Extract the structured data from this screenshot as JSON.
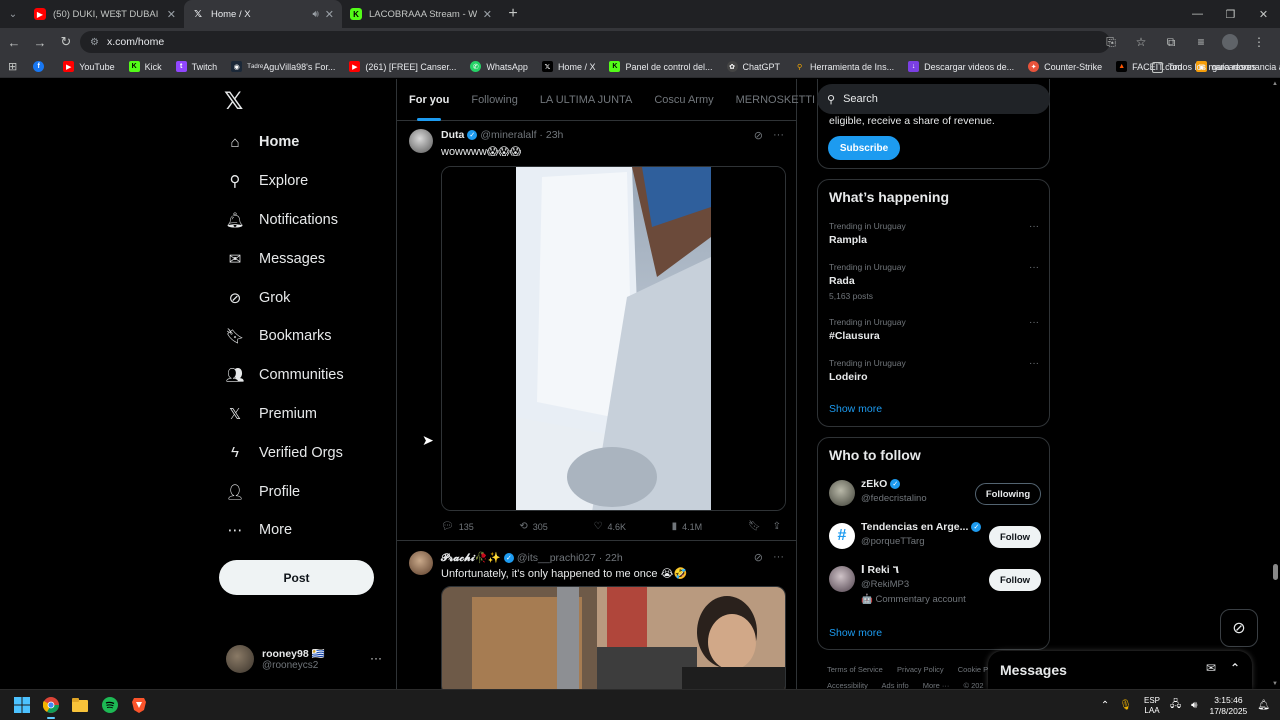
{
  "browser": {
    "tabs": [
      {
        "title": "(50) DUKI, WE$T DUBAI - cONT",
        "favicon": "youtube-icon",
        "color": "#ff0000",
        "active": false
      },
      {
        "title": "Home / X",
        "favicon": "x-icon",
        "color": "#000000",
        "active": true
      },
      {
        "title": "LACOBRAAA Stream - Watch Li",
        "favicon": "kick-icon",
        "color": "#53fc18",
        "active": false
      }
    ],
    "url": "x.com/home",
    "bookmarks": [
      {
        "label": "",
        "icon": "facebook-icon",
        "color": "#1877f2"
      },
      {
        "label": "YouTube",
        "icon": "youtube-icon",
        "color": "#ff0000"
      },
      {
        "label": "Kick",
        "icon": "kick-icon",
        "color": "#53fc18"
      },
      {
        "label": "Twitch",
        "icon": "twitch-icon",
        "color": "#9146ff"
      },
      {
        "label": "ᵀᵃᵈʳᵉAguVilla98's For...",
        "icon": "steam-icon",
        "color": "#1b2838"
      },
      {
        "label": "(261) [FREE] Canser...",
        "icon": "youtube-icon",
        "color": "#ff0000"
      },
      {
        "label": "WhatsApp",
        "icon": "whatsapp-icon",
        "color": "#25d366"
      },
      {
        "label": "Home / X",
        "icon": "x-icon",
        "color": "#000000"
      },
      {
        "label": "Panel de control del...",
        "icon": "kick-icon",
        "color": "#53fc18"
      },
      {
        "label": "ChatGPT",
        "icon": "chatgpt-icon",
        "color": "#444444"
      },
      {
        "label": "Herramienta de Ins...",
        "icon": "search-icon",
        "color": "#f9ab00"
      },
      {
        "label": "Descargar videos de...",
        "icon": "download-icon",
        "color": "#7b3fe4"
      },
      {
        "label": "Counter-Strike",
        "icon": "cs-icon",
        "color": "#e8533b"
      },
      {
        "label": "FACEIT.com",
        "icon": "faceit-icon",
        "color": "#ff5500"
      },
      {
        "label": "guía resonancia aud...",
        "icon": "guide-icon",
        "color": "#f59e0b"
      }
    ],
    "all_bookmarks": "Todos los marcadores"
  },
  "nav": {
    "items": [
      {
        "label": "Home",
        "icon": "home-icon",
        "active": true
      },
      {
        "label": "Explore",
        "icon": "search-icon"
      },
      {
        "label": "Notifications",
        "icon": "bell-icon"
      },
      {
        "label": "Messages",
        "icon": "envelope-icon"
      },
      {
        "label": "Grok",
        "icon": "grok-icon"
      },
      {
        "label": "Bookmarks",
        "icon": "bookmark-icon"
      },
      {
        "label": "Communities",
        "icon": "people-icon"
      },
      {
        "label": "Premium",
        "icon": "x-icon"
      },
      {
        "label": "Verified Orgs",
        "icon": "lightning-icon"
      },
      {
        "label": "Profile",
        "icon": "person-icon"
      },
      {
        "label": "More",
        "icon": "more-circle-icon"
      }
    ],
    "post_label": "Post",
    "account": {
      "name": "rooney98 🇺🇾",
      "handle": "@rooneycs2"
    }
  },
  "timeline": {
    "tabs": [
      "For you",
      "Following",
      "LA ULTIMA JUNTA",
      "Coscu Army",
      "MERNOSKETTI"
    ],
    "tweets": [
      {
        "name": "Duta",
        "handle": "@mineralalf · 23h",
        "text": "wowwww😱😱😱",
        "stats": {
          "replies": "135",
          "reposts": "305",
          "likes": "4.6K",
          "views": "4.1M"
        }
      },
      {
        "name": "𝓟𝓻𝓪𝓬𝓱𝓲🥀✨",
        "handle": "@its__prachi027 · 22h",
        "text": "Unfortunately, it's only happened to me once 😭🤣"
      }
    ]
  },
  "right": {
    "search_placeholder": "Search",
    "premium_text": "eligible, receive a share of revenue.",
    "subscribe_label": "Subscribe",
    "happening_title": "What’s happening",
    "trends": [
      {
        "category": "Trending in Uruguay",
        "topic": "Rampla",
        "count": ""
      },
      {
        "category": "Trending in Uruguay",
        "topic": "Rada",
        "count": "5,163 posts"
      },
      {
        "category": "Trending in Uruguay",
        "topic": "#Clausura",
        "count": ""
      },
      {
        "category": "Trending in Uruguay",
        "topic": "Lodeiro",
        "count": ""
      }
    ],
    "show_more": "Show more",
    "who_title": "Who to follow",
    "follows": [
      {
        "name": "zEkO",
        "handle": "@fedecristalino",
        "extra": "",
        "button": "Following",
        "verified": true
      },
      {
        "name": "Tendencias en Arge...",
        "handle": "@porqueTTarg",
        "extra": "",
        "button": "Follow",
        "verified": true
      },
      {
        "name": "ا Reki ٦",
        "handle": "@RekiMP3",
        "extra": "🤖 Commentary account",
        "button": "Follow",
        "verified": false
      }
    ],
    "footer": [
      "Terms of Service",
      "Privacy Policy",
      "Cookie P"
    ],
    "footer2": [
      "Accessibility",
      "Ads info",
      "More ···",
      "© 202"
    ],
    "messages_label": "Messages"
  },
  "taskbar": {
    "lang": [
      "ESP",
      "LAA"
    ],
    "time": "3:15:46",
    "date": "17/8/2025"
  }
}
